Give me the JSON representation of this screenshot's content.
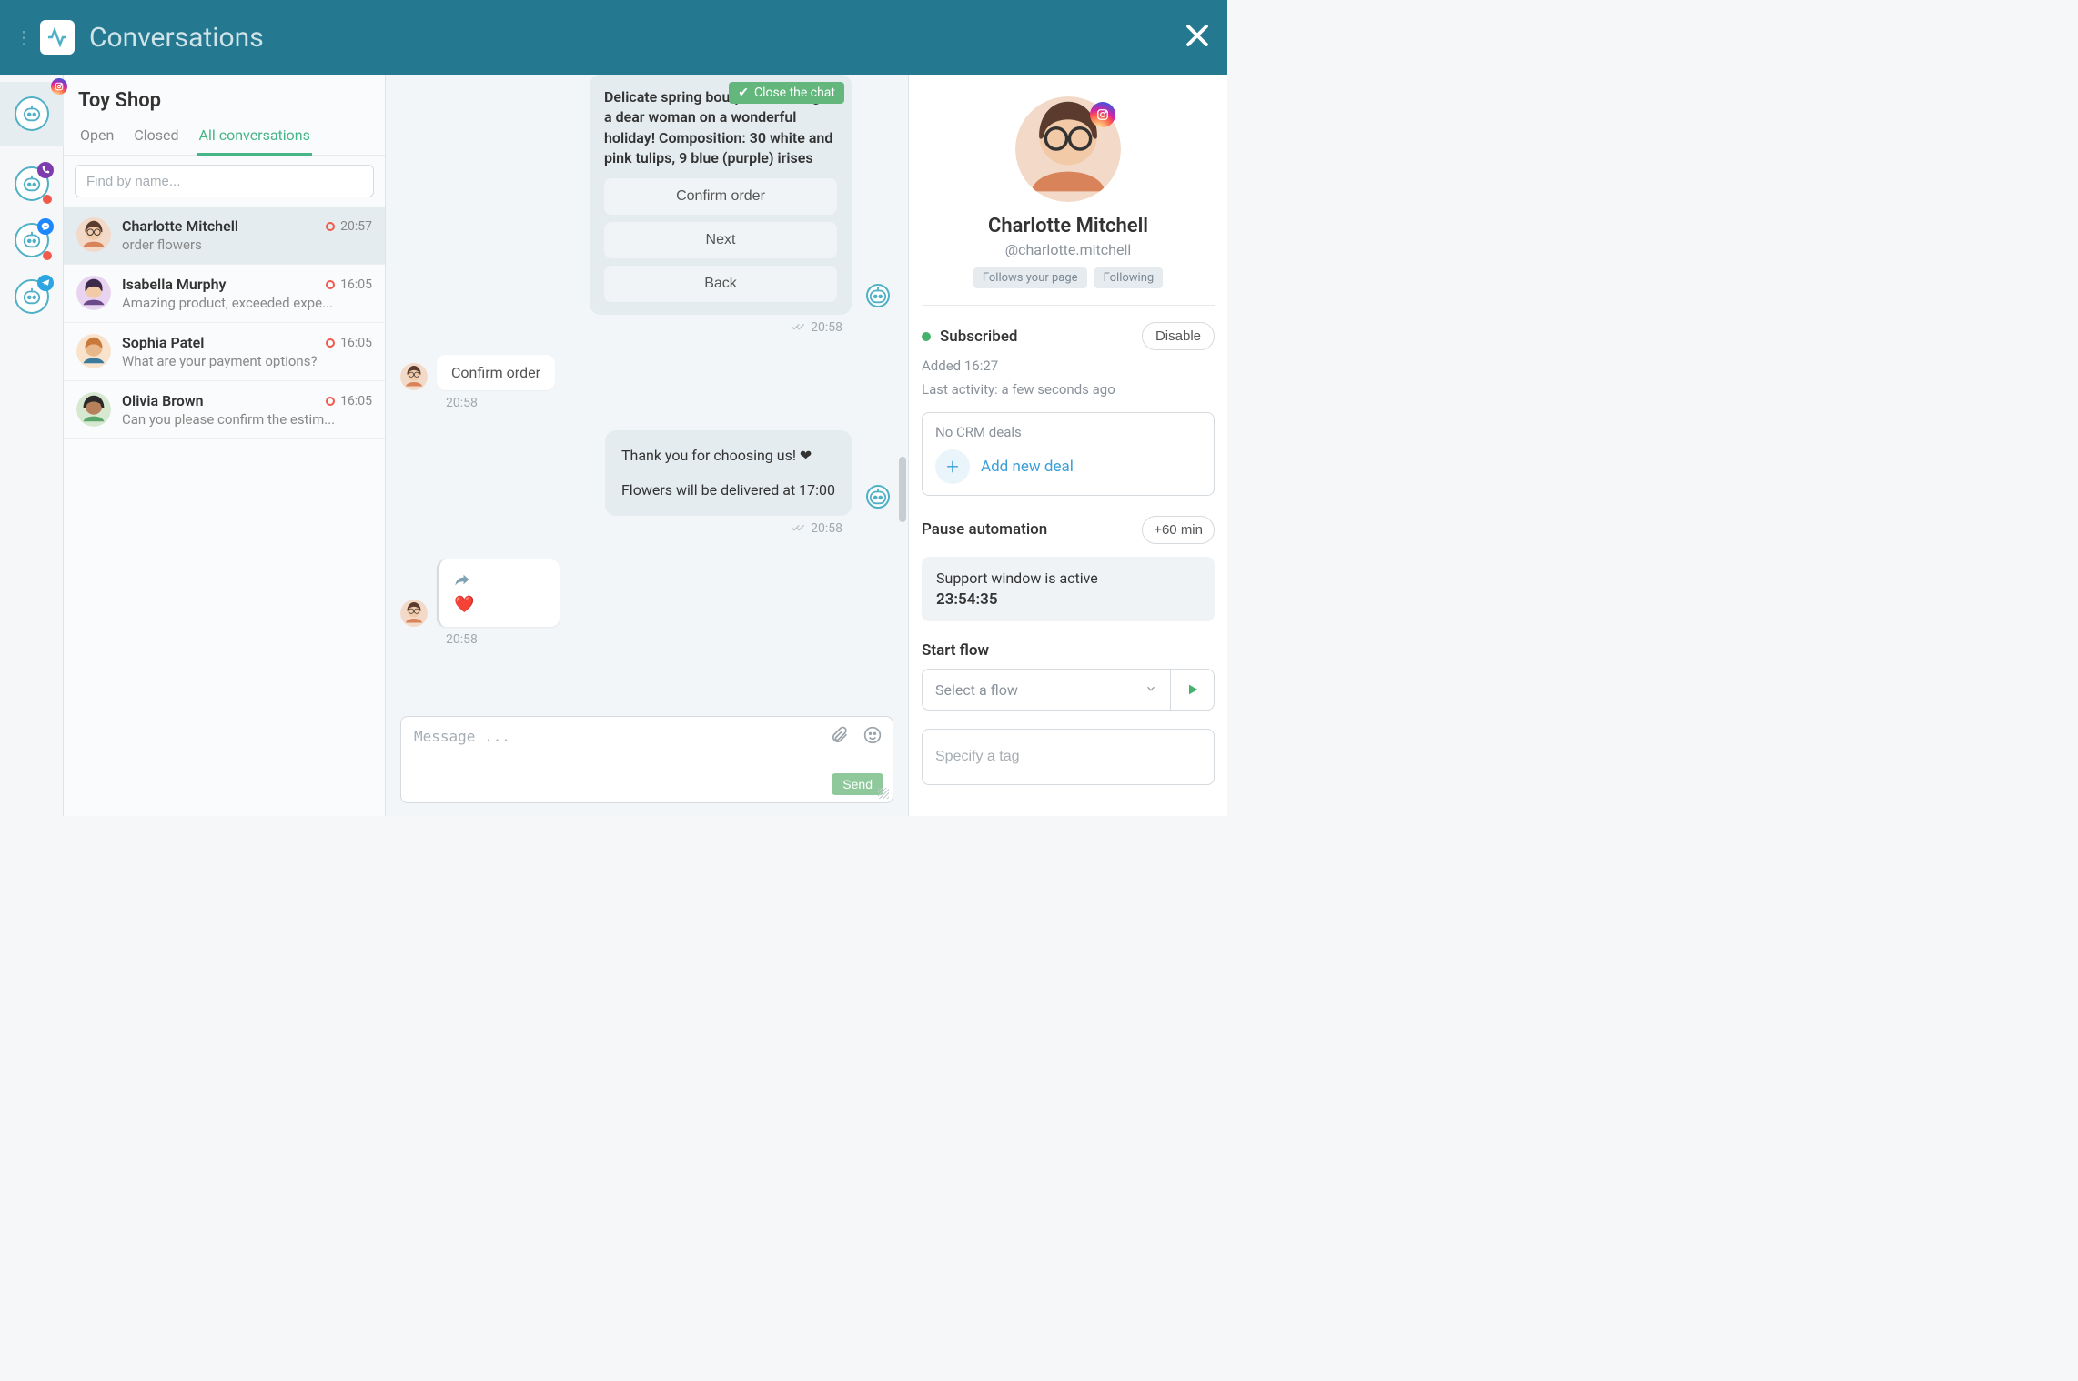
{
  "topbar": {
    "title": "Conversations"
  },
  "rail": {
    "items": [
      {
        "badge": "instagram",
        "active": true
      },
      {
        "badge": "viber",
        "dot": true
      },
      {
        "badge": "messenger",
        "dot": true
      },
      {
        "badge": "telegram"
      }
    ]
  },
  "list": {
    "title": "Toy Shop",
    "tabs": {
      "open": "Open",
      "closed": "Closed",
      "all": "All conversations"
    },
    "search_placeholder": "Find by name...",
    "items": [
      {
        "name": "Charlotte Mitchell",
        "preview": "order flowers",
        "time": "20:57",
        "selected": true
      },
      {
        "name": "Isabella Murphy",
        "preview": "Amazing product, exceeded expe...",
        "time": "16:05"
      },
      {
        "name": "Sophia Patel",
        "preview": "What are your payment options?",
        "time": "16:05"
      },
      {
        "name": "Olivia Brown",
        "preview": "Can you please confirm the estim...",
        "time": "16:05"
      }
    ]
  },
  "chat": {
    "close_chat": "Close the chat",
    "intro_text": "Delicate spring bouquet will delight a dear woman on a wonderful holiday! Composition: 30 white and pink tulips, 9 blue (purple) irises",
    "actions": {
      "confirm": "Confirm order",
      "next": "Next",
      "back": "Back"
    },
    "t_intro": "20:58",
    "user_confirm": "Confirm order",
    "t_user_confirm": "20:58",
    "thanks_line1": "Thank you for choosing us! ❤",
    "thanks_line2": "Flowers will be delivered at 17:00",
    "t_thanks": "20:58",
    "reaction": "❤️",
    "t_reaction": "20:58",
    "composer_placeholder": "Message ...",
    "send": "Send"
  },
  "profile": {
    "name": "Charlotte Mitchell",
    "handle": "@charlotte.mitchell",
    "badge_follows": "Follows your page",
    "badge_following": "Following",
    "subscribed": "Subscribed",
    "disable": "Disable",
    "added": "Added 16:27",
    "last_activity": "Last activity: a few seconds ago",
    "crm_none": "No CRM deals",
    "add_deal": "Add new deal",
    "pause": "Pause automation",
    "plus60": "+60 min",
    "support_active": "Support window is active",
    "support_time": "23:54:35",
    "start_flow": "Start flow",
    "select_flow": "Select a flow",
    "tag_placeholder": "Specify a tag"
  }
}
